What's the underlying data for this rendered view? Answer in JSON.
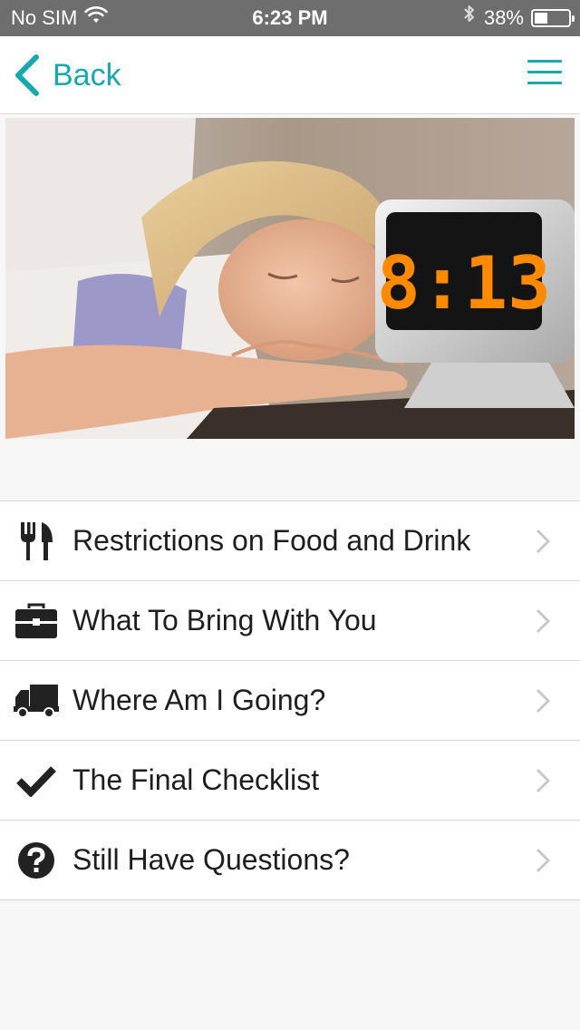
{
  "status_bar": {
    "carrier": "No SIM",
    "time": "6:23 PM",
    "battery_percent": "38%",
    "battery_level": 0.38
  },
  "nav": {
    "back_label": "Back",
    "accent_color": "#17a9ad"
  },
  "hero": {
    "clock_display": "8:13"
  },
  "menu_items": [
    {
      "label": "Restrictions on Food and Drink",
      "icon": "utensils-icon"
    },
    {
      "label": "What To Bring With You",
      "icon": "briefcase-icon"
    },
    {
      "label": "Where Am I Going?",
      "icon": "truck-icon"
    },
    {
      "label": "The Final Checklist",
      "icon": "checkmark-icon"
    },
    {
      "label": "Still Have Questions?",
      "icon": "question-circle-icon"
    }
  ]
}
